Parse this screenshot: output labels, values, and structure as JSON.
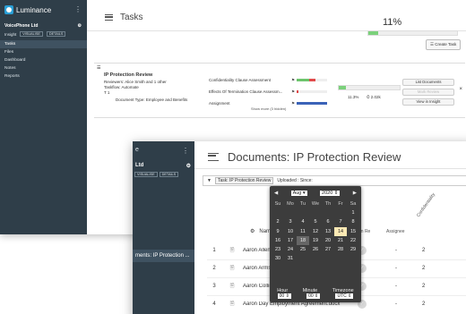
{
  "back": {
    "brand": "Luminance",
    "org": "VoicePhone Ltd",
    "insight_label": "Insight",
    "visualise": "VISUALISE",
    "details": "DETAILS",
    "nav": [
      "Tasks",
      "Files",
      "Dashboard",
      "Notes",
      "Reports"
    ],
    "title": "Tasks",
    "progress_pct": "11%",
    "progress_value": 0.11,
    "create_task": "Create Task",
    "task": {
      "name": "IP Protection Review",
      "reviewers": "Reviewers: Alice Smith and 1 other",
      "taskflow": "Taskflow: Automate",
      "t": "T 1",
      "doc_type": "Document Type: Employee and Benefits",
      "clauses": [
        {
          "name": "Confidentiality Clause Assessment"
        },
        {
          "name": "Effects Of Termination Clause Assessm..."
        },
        {
          "name": "Assignment"
        }
      ],
      "show_more": "Show more (3 hidden)",
      "pct": "11.3%",
      "days": "2.02k",
      "progress_value": 0.113,
      "btn_list": "List Documents",
      "btn_mark": "Mark Review",
      "btn_insight": "View in Insight"
    }
  },
  "front": {
    "sidebar_letter": "e",
    "sidebar_org": "Ltd",
    "visualise": "VISUALISE",
    "details": "DETAILS",
    "sidebar_doc": "ments: IP Protection ...",
    "title": "Documents: IP Protection Review",
    "filter_task": "Task: IP Protection Review",
    "filter_uploaded": "Uploaded : Since:",
    "col_name": "Name",
    "col_section": "ction Re",
    "col_assignee": "Assignee",
    "col_conf": "Confidentiality",
    "rows": [
      {
        "num": "1",
        "name": "Aaron Allen Er",
        "dash": "-",
        "val": "2"
      },
      {
        "num": "2",
        "name": "Aaron Armstro",
        "dash": "-",
        "val": "2"
      },
      {
        "num": "3",
        "name": "Aaron Collins E",
        "dash": "-",
        "val": "2"
      },
      {
        "num": "4",
        "name": "Aaron Day Employment Agreement.docx",
        "dash": "-",
        "val": "2"
      }
    ],
    "picker": {
      "month": "Aug",
      "year": "2020",
      "days_of_week": [
        "Su",
        "Mo",
        "Tu",
        "We",
        "Th",
        "Fr",
        "Sa"
      ],
      "weeks": [
        [
          "",
          "",
          "",
          "",
          "",
          "",
          "1"
        ],
        [
          "2",
          "3",
          "4",
          "5",
          "6",
          "7",
          "8"
        ],
        [
          "9",
          "10",
          "11",
          "12",
          "13",
          "14",
          "15"
        ],
        [
          "16",
          "17",
          "18",
          "19",
          "20",
          "21",
          "22"
        ],
        [
          "23",
          "24",
          "25",
          "26",
          "27",
          "28",
          "29"
        ],
        [
          "30",
          "31",
          "",
          "",
          "",
          "",
          ""
        ]
      ],
      "today": "14",
      "hover": "18",
      "hour_label": "Hour",
      "minute_label": "Minute",
      "timezone_label": "Timezone",
      "hour": "00",
      "minute": "00",
      "timezone": "UTC"
    }
  },
  "colors": {
    "sidebar": "#2f3e49",
    "progress": "#7bd17b",
    "picker_bg": "#3c3c3c",
    "today": "#fce9b4"
  }
}
